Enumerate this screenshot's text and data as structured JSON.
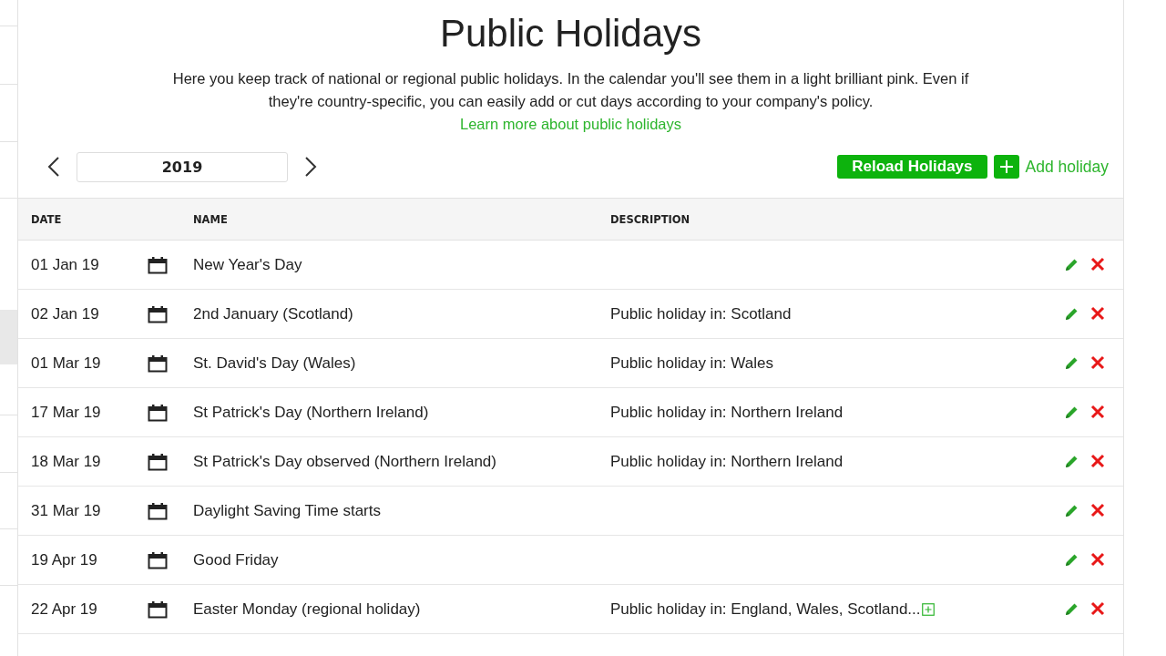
{
  "header": {
    "title": "Public Holidays",
    "intro": "Here you keep track of national or regional public holidays. In the calendar you'll see them in a light brilliant pink. Even if they're country-specific, you can easily add or cut days according to your company's policy.",
    "link": "Learn more about public holidays"
  },
  "year": {
    "value": "2019"
  },
  "buttons": {
    "reload": "Reload Holidays",
    "add": "Add holiday"
  },
  "table": {
    "columns": [
      "DATE",
      "NAME",
      "DESCRIPTION"
    ],
    "rows": [
      {
        "date": "01 Jan 19",
        "name": "New Year's Day",
        "description": "",
        "more": false
      },
      {
        "date": "02 Jan 19",
        "name": "2nd January (Scotland)",
        "description": "Public holiday in: Scotland",
        "more": false
      },
      {
        "date": "01 Mar 19",
        "name": "St. David's Day (Wales)",
        "description": "Public holiday in: Wales",
        "more": false
      },
      {
        "date": "17 Mar 19",
        "name": "St Patrick's Day (Northern Ireland)",
        "description": "Public holiday in: Northern Ireland",
        "more": false
      },
      {
        "date": "18 Mar 19",
        "name": "St Patrick's Day observed (Northern Ireland)",
        "description": "Public holiday in: Northern Ireland",
        "more": false
      },
      {
        "date": "31 Mar 19",
        "name": "Daylight Saving Time starts",
        "description": "",
        "more": false
      },
      {
        "date": "19 Apr 19",
        "name": "Good Friday",
        "description": "",
        "more": false
      },
      {
        "date": "22 Apr 19",
        "name": "Easter Monday (regional holiday)",
        "description": "Public holiday in: England, Wales, Scotland...",
        "more": true
      }
    ]
  }
}
